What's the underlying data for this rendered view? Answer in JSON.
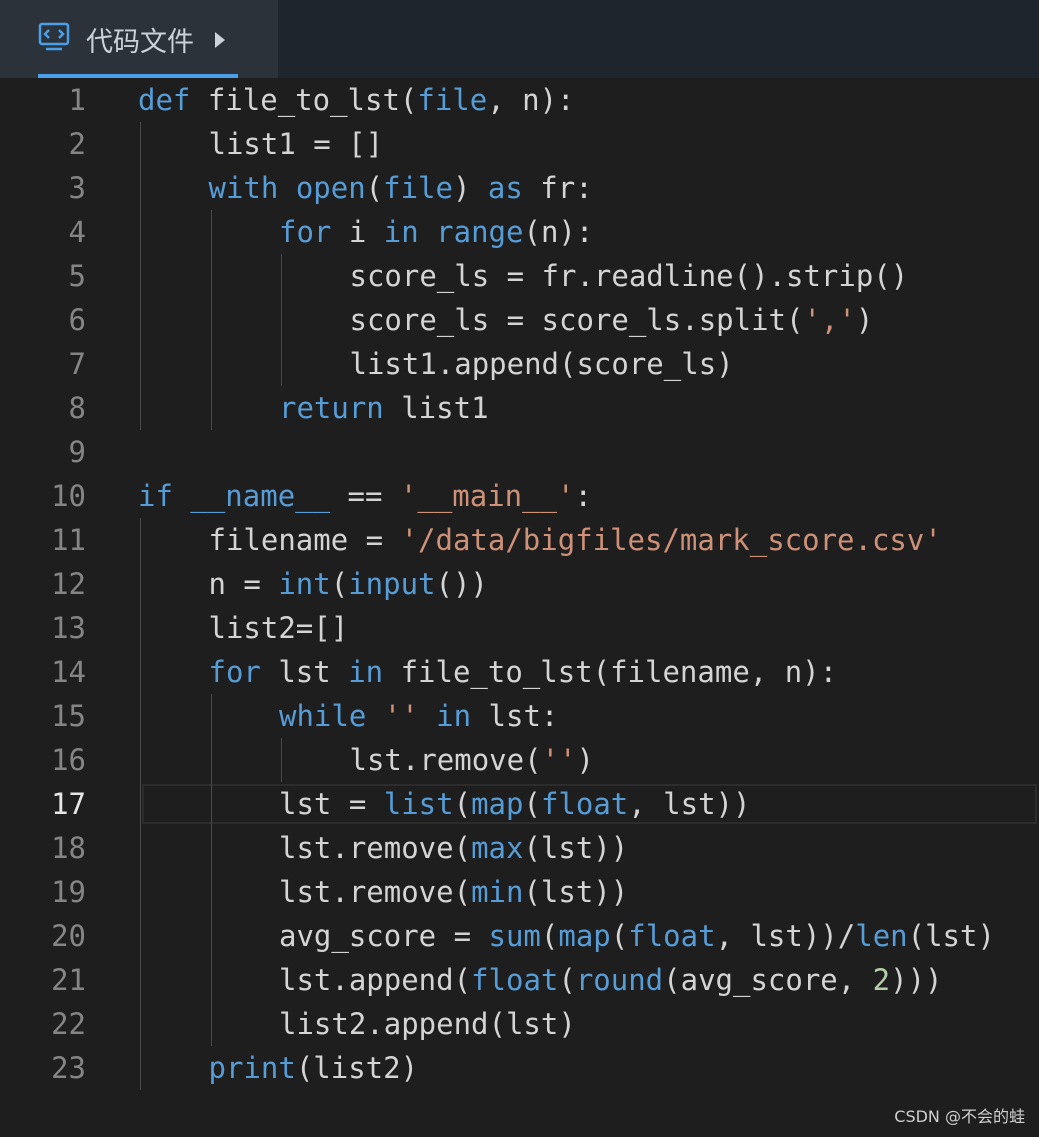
{
  "tab": {
    "icon": "code-file-icon",
    "title": "代码文件",
    "arrow_icon": "play-arrow-icon"
  },
  "editor": {
    "language": "python",
    "active_line": 17,
    "colors": {
      "background": "#1e1e1e",
      "keyword": "#569cd6",
      "string": "#ce9178",
      "number": "#b5cea8",
      "text": "#d4d4d4",
      "line_number": "#858585"
    },
    "lines": [
      {
        "num": "1",
        "indent": 0,
        "tokens": [
          {
            "t": "def",
            "c": "kw"
          },
          {
            "t": " file_to_lst("
          },
          {
            "t": "file",
            "c": "kw"
          },
          {
            "t": ", n):"
          }
        ]
      },
      {
        "num": "2",
        "indent": 1,
        "tokens": [
          {
            "t": "list1 = []"
          }
        ]
      },
      {
        "num": "3",
        "indent": 1,
        "tokens": [
          {
            "t": "with",
            "c": "kw"
          },
          {
            "t": " "
          },
          {
            "t": "open",
            "c": "kw"
          },
          {
            "t": "("
          },
          {
            "t": "file",
            "c": "kw"
          },
          {
            "t": ") "
          },
          {
            "t": "as",
            "c": "kw"
          },
          {
            "t": " fr:"
          }
        ]
      },
      {
        "num": "4",
        "indent": 2,
        "tokens": [
          {
            "t": "for",
            "c": "kw"
          },
          {
            "t": " i "
          },
          {
            "t": "in",
            "c": "kw"
          },
          {
            "t": " "
          },
          {
            "t": "range",
            "c": "kw"
          },
          {
            "t": "(n):"
          }
        ]
      },
      {
        "num": "5",
        "indent": 3,
        "tokens": [
          {
            "t": "score_ls = fr.readline().strip()"
          }
        ]
      },
      {
        "num": "6",
        "indent": 3,
        "tokens": [
          {
            "t": "score_ls = score_ls.split("
          },
          {
            "t": "','",
            "c": "str"
          },
          {
            "t": ")"
          }
        ]
      },
      {
        "num": "7",
        "indent": 3,
        "tokens": [
          {
            "t": "list1.append(score_ls)"
          }
        ]
      },
      {
        "num": "8",
        "indent": 2,
        "tokens": [
          {
            "t": "return",
            "c": "kw"
          },
          {
            "t": " list1"
          }
        ]
      },
      {
        "num": "9",
        "indent": 0,
        "tokens": []
      },
      {
        "num": "10",
        "indent": 0,
        "tokens": [
          {
            "t": "if",
            "c": "kw"
          },
          {
            "t": " "
          },
          {
            "t": "__name__",
            "c": "kw"
          },
          {
            "t": " == "
          },
          {
            "t": "'__main__'",
            "c": "str"
          },
          {
            "t": ":"
          }
        ]
      },
      {
        "num": "11",
        "indent": 1,
        "tokens": [
          {
            "t": "filename = "
          },
          {
            "t": "'/data/bigfiles/mark_score.csv'",
            "c": "str"
          }
        ]
      },
      {
        "num": "12",
        "indent": 1,
        "tokens": [
          {
            "t": "n = "
          },
          {
            "t": "int",
            "c": "kw"
          },
          {
            "t": "("
          },
          {
            "t": "input",
            "c": "kw"
          },
          {
            "t": "())"
          }
        ]
      },
      {
        "num": "13",
        "indent": 1,
        "tokens": [
          {
            "t": "list2=[]"
          }
        ]
      },
      {
        "num": "14",
        "indent": 1,
        "tokens": [
          {
            "t": "for",
            "c": "kw"
          },
          {
            "t": " lst "
          },
          {
            "t": "in",
            "c": "kw"
          },
          {
            "t": " file_to_lst(filename, n):"
          }
        ]
      },
      {
        "num": "15",
        "indent": 2,
        "tokens": [
          {
            "t": "while",
            "c": "kw"
          },
          {
            "t": " "
          },
          {
            "t": "''",
            "c": "str"
          },
          {
            "t": " "
          },
          {
            "t": "in",
            "c": "kw"
          },
          {
            "t": " lst:"
          }
        ]
      },
      {
        "num": "16",
        "indent": 3,
        "tokens": [
          {
            "t": "lst.remove("
          },
          {
            "t": "''",
            "c": "str"
          },
          {
            "t": ")"
          }
        ]
      },
      {
        "num": "17",
        "indent": 2,
        "tokens": [
          {
            "t": "lst = "
          },
          {
            "t": "list",
            "c": "kw"
          },
          {
            "t": "("
          },
          {
            "t": "map",
            "c": "kw"
          },
          {
            "t": "("
          },
          {
            "t": "float",
            "c": "kw"
          },
          {
            "t": ", lst))"
          }
        ]
      },
      {
        "num": "18",
        "indent": 2,
        "tokens": [
          {
            "t": "lst.remove("
          },
          {
            "t": "max",
            "c": "kw"
          },
          {
            "t": "(lst))"
          }
        ]
      },
      {
        "num": "19",
        "indent": 2,
        "tokens": [
          {
            "t": "lst.remove("
          },
          {
            "t": "min",
            "c": "kw"
          },
          {
            "t": "(lst))"
          }
        ]
      },
      {
        "num": "20",
        "indent": 2,
        "tokens": [
          {
            "t": "avg_score = "
          },
          {
            "t": "sum",
            "c": "kw"
          },
          {
            "t": "("
          },
          {
            "t": "map",
            "c": "kw"
          },
          {
            "t": "("
          },
          {
            "t": "float",
            "c": "kw"
          },
          {
            "t": ", lst))/"
          },
          {
            "t": "len",
            "c": "kw"
          },
          {
            "t": "(lst)"
          }
        ]
      },
      {
        "num": "21",
        "indent": 2,
        "tokens": [
          {
            "t": "lst.append("
          },
          {
            "t": "float",
            "c": "kw"
          },
          {
            "t": "("
          },
          {
            "t": "round",
            "c": "kw"
          },
          {
            "t": "(avg_score, "
          },
          {
            "t": "2",
            "c": "num"
          },
          {
            "t": ")))"
          }
        ]
      },
      {
        "num": "22",
        "indent": 2,
        "tokens": [
          {
            "t": "list2.append(lst)"
          }
        ]
      },
      {
        "num": "23",
        "indent": 1,
        "tokens": [
          {
            "t": "print",
            "c": "kw"
          },
          {
            "t": "(list2)"
          }
        ]
      }
    ]
  },
  "watermark": "CSDN @不会的蛙"
}
